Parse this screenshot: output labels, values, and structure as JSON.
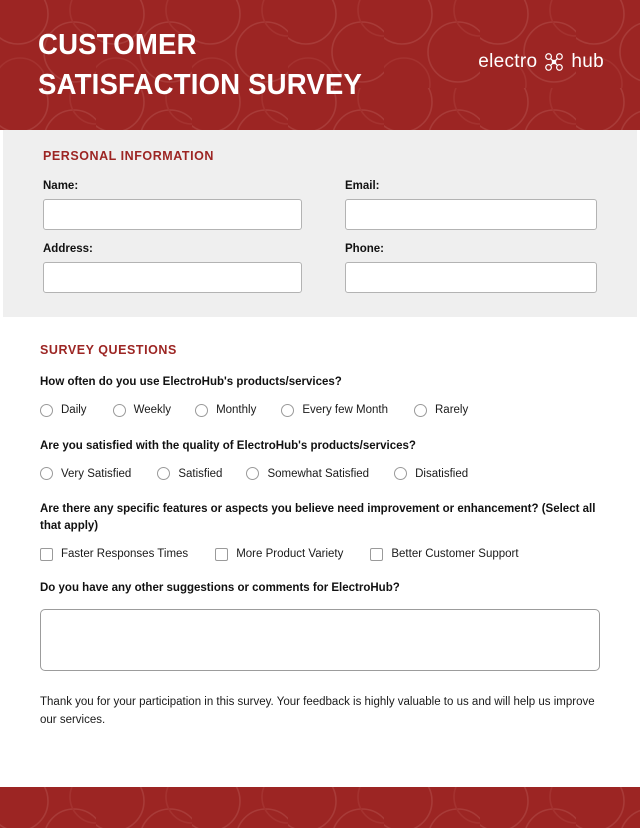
{
  "theme": {
    "brand_red": "#9c2523",
    "band_grey": "#efefef",
    "text_dark": "#111111"
  },
  "header": {
    "title": "CUSTOMER\nSATISFACTION SURVEY",
    "logo": {
      "word_left": "electro",
      "icon": "drone-icon",
      "word_right": "hub"
    }
  },
  "personal_information": {
    "heading": "PERSONAL INFORMATION",
    "fields": [
      {
        "label": "Name:",
        "value": "",
        "placeholder": ""
      },
      {
        "label": "Email:",
        "value": "",
        "placeholder": ""
      },
      {
        "label": "Address:",
        "value": "",
        "placeholder": ""
      },
      {
        "label": "Phone:",
        "value": "",
        "placeholder": ""
      }
    ]
  },
  "survey": {
    "heading": "SURVEY QUESTIONS",
    "questions": [
      {
        "text": "How often do you use ElectroHub's products/services?",
        "type": "radio",
        "options": [
          "Daily",
          "Weekly",
          "Monthly",
          "Every few Month",
          "Rarely"
        ]
      },
      {
        "text": "Are you satisfied with the quality of ElectroHub's products/services?",
        "type": "radio",
        "options": [
          "Very Satisfied",
          "Satisfied",
          "Somewhat Satisfied",
          "Disatisfied"
        ]
      },
      {
        "text": "Are there any specific features or aspects you believe need improvement or enhancement? (Select all that apply)",
        "type": "checkbox",
        "options": [
          "Faster Responses Times",
          "More Product Variety",
          "Better Customer Support"
        ]
      },
      {
        "text": "Do you have any other suggestions or comments for ElectroHub?",
        "type": "textarea",
        "value": "",
        "placeholder": ""
      }
    ]
  },
  "footer": {
    "thank_you": "Thank you for your participation in this survey. Your feedback is highly valuable to us and will help us improve our services."
  }
}
